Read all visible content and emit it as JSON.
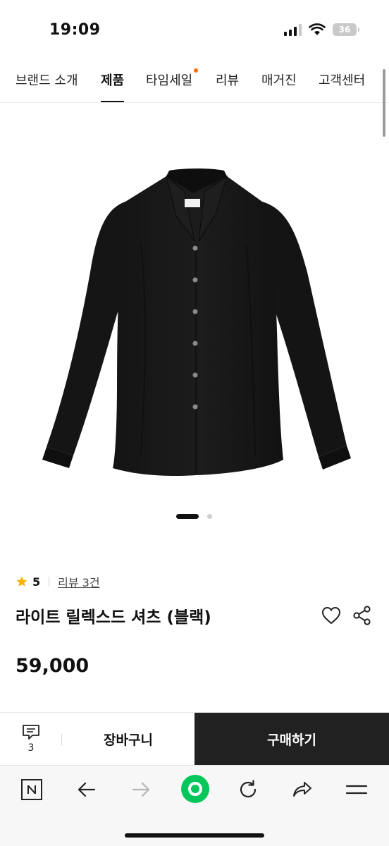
{
  "status_bar": {
    "time": "19:09",
    "battery": "36"
  },
  "nav": {
    "tabs": [
      {
        "label": "브랜드 소개"
      },
      {
        "label": "제품",
        "active": true
      },
      {
        "label": "타임세일",
        "has_new_dot": true
      },
      {
        "label": "리뷰"
      },
      {
        "label": "매거진"
      },
      {
        "label": "고객센터"
      }
    ]
  },
  "carousel": {
    "total": 2,
    "current": 1
  },
  "product": {
    "rating": "5",
    "review_link": "리뷰 3건",
    "title": "라이트 릴렉스드 셔츠 (블랙)",
    "price": "59,000"
  },
  "purchase_bar": {
    "comment_count": "3",
    "cart_label": "장바구니",
    "buy_label": "구매하기"
  },
  "toolbar": {
    "icons": [
      "naver-n-icon",
      "back-arrow-icon",
      "forward-arrow-icon",
      "green-home-icon",
      "refresh-icon",
      "share-icon",
      "menu-icon"
    ]
  },
  "colors": {
    "accent_dot": "#ff6a00",
    "star": "#f5b400",
    "buy_button": "#212121",
    "green_button": "#03c75a"
  }
}
